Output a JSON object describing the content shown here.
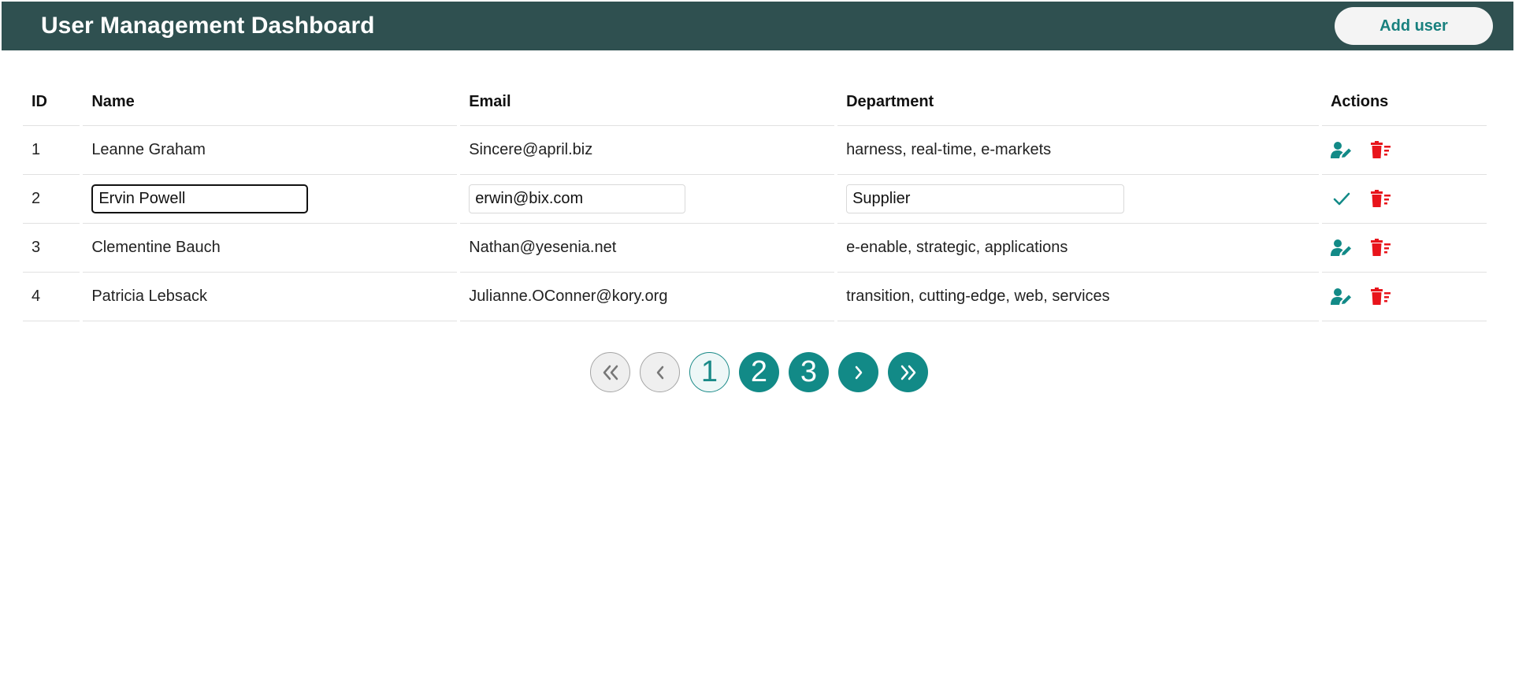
{
  "header": {
    "title": "User Management Dashboard",
    "add_user_label": "Add user"
  },
  "table": {
    "columns": [
      "ID",
      "Name",
      "Email",
      "Department",
      "Actions"
    ],
    "rows": [
      {
        "id": "1",
        "name": "Leanne Graham",
        "email": "Sincere@april.biz",
        "department": "harness, real-time, e-markets",
        "editing": false
      },
      {
        "id": "2",
        "name": "Ervin Powell",
        "email": "erwin@bix.com",
        "department": "Supplier",
        "editing": true
      },
      {
        "id": "3",
        "name": "Clementine Bauch",
        "email": "Nathan@yesenia.net",
        "department": "e-enable, strategic, applications",
        "editing": false
      },
      {
        "id": "4",
        "name": "Patricia Lebsack",
        "email": "Julianne.OConner@kory.org",
        "department": "transition, cutting-edge, web, services",
        "editing": false
      }
    ]
  },
  "pagination": {
    "first": "«",
    "prev": "‹",
    "pages": [
      "1",
      "2",
      "3"
    ],
    "current_page": "1",
    "next": "›",
    "last": "»"
  },
  "icons": {
    "edit": "user-edit-icon",
    "delete": "trash-delete-icon",
    "save": "check-icon"
  },
  "colors": {
    "header_bg": "#2f5050",
    "accent": "#128a87",
    "delete": "#e8141b"
  }
}
